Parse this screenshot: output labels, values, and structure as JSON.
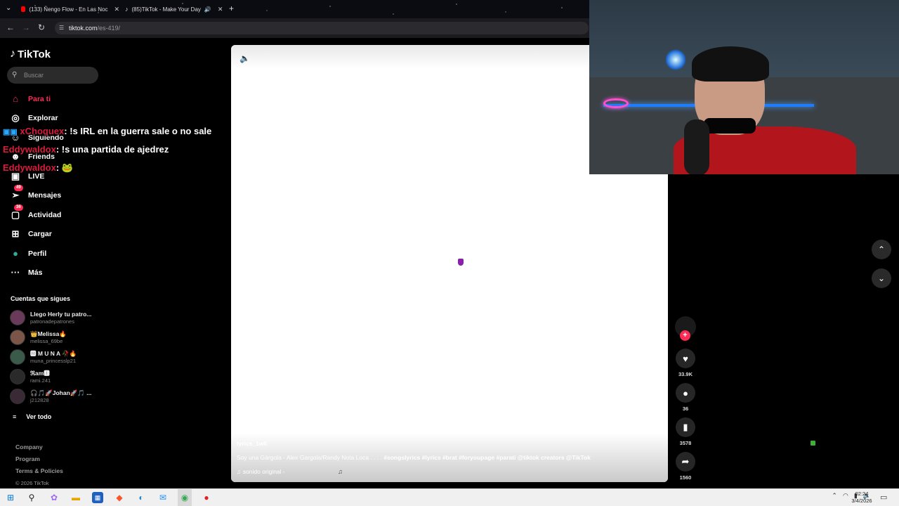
{
  "browser": {
    "tabs": [
      {
        "title": "(133) Ñengo Flow - En Las Noc",
        "favicon_color": "#ff0000"
      },
      {
        "title": "(85)TikTok - Make Your Day",
        "favicon_color": "#ffffff"
      }
    ],
    "url_host": "tiktok.com",
    "url_path": "/es-419/"
  },
  "sidebar": {
    "logo": "TikTok",
    "search_placeholder": "Buscar",
    "nav": [
      {
        "label": "Para ti",
        "icon": "home-icon",
        "active": true
      },
      {
        "label": "Explorar",
        "icon": "compass-icon"
      },
      {
        "label": "Siguiendo",
        "icon": "following-icon"
      },
      {
        "label": "Friends",
        "icon": "friends-icon"
      },
      {
        "label": "LIVE",
        "icon": "live-icon"
      },
      {
        "label": "Mensajes",
        "icon": "messages-icon",
        "badge": "49"
      },
      {
        "label": "Actividad",
        "icon": "activity-icon",
        "badge": "36"
      },
      {
        "label": "Cargar",
        "icon": "upload-icon"
      },
      {
        "label": "Perfil",
        "icon": "profile-icon"
      },
      {
        "label": "Más",
        "icon": "more-icon"
      }
    ],
    "following_title": "Cuentas que sigues",
    "accounts": [
      {
        "name": "Llego Herly tu patro...",
        "handle": "patronadepatrones"
      },
      {
        "name": "👑Melissa🔥",
        "handle": "melissa_69be"
      },
      {
        "name": "🅼 M U N A 🥀🔥",
        "handle": "muna_princesslp21"
      },
      {
        "name": "ℜam🅸",
        "handle": "rami.241"
      },
      {
        "name": "🎧🎵🚀Johan🚀🎵 ...",
        "handle": "j212828"
      }
    ],
    "see_all": "Ver todo",
    "footer": {
      "company": "Company",
      "program": "Program",
      "terms": "Terms & Policies",
      "copyright": "© 2026 TikTok"
    }
  },
  "chat": [
    {
      "user": "xChoquex",
      "message": ": !s IRL en la guerra sale o no sale"
    },
    {
      "user": "Eddywaldox",
      "message": ": !s una partida de ajedrez"
    },
    {
      "user": "Eddywaldox",
      "message": ": 🐸"
    }
  ],
  "video": {
    "username": "lyrics_1w6",
    "description_text": "Soy una Gárgola - Alex Gargola/Randy Nota Loca . . . . ",
    "description_tags": "#songslyrics #lyrics #brat #foryoupage #parati @tiktok creators @TikTok",
    "sound": "♫ sonido original -"
  },
  "actions": {
    "likes": "33.9K",
    "comments": "36",
    "saves": "3578",
    "shares": "1560"
  },
  "taskbar": {
    "time": "02:24",
    "date": "3/4/2026"
  }
}
